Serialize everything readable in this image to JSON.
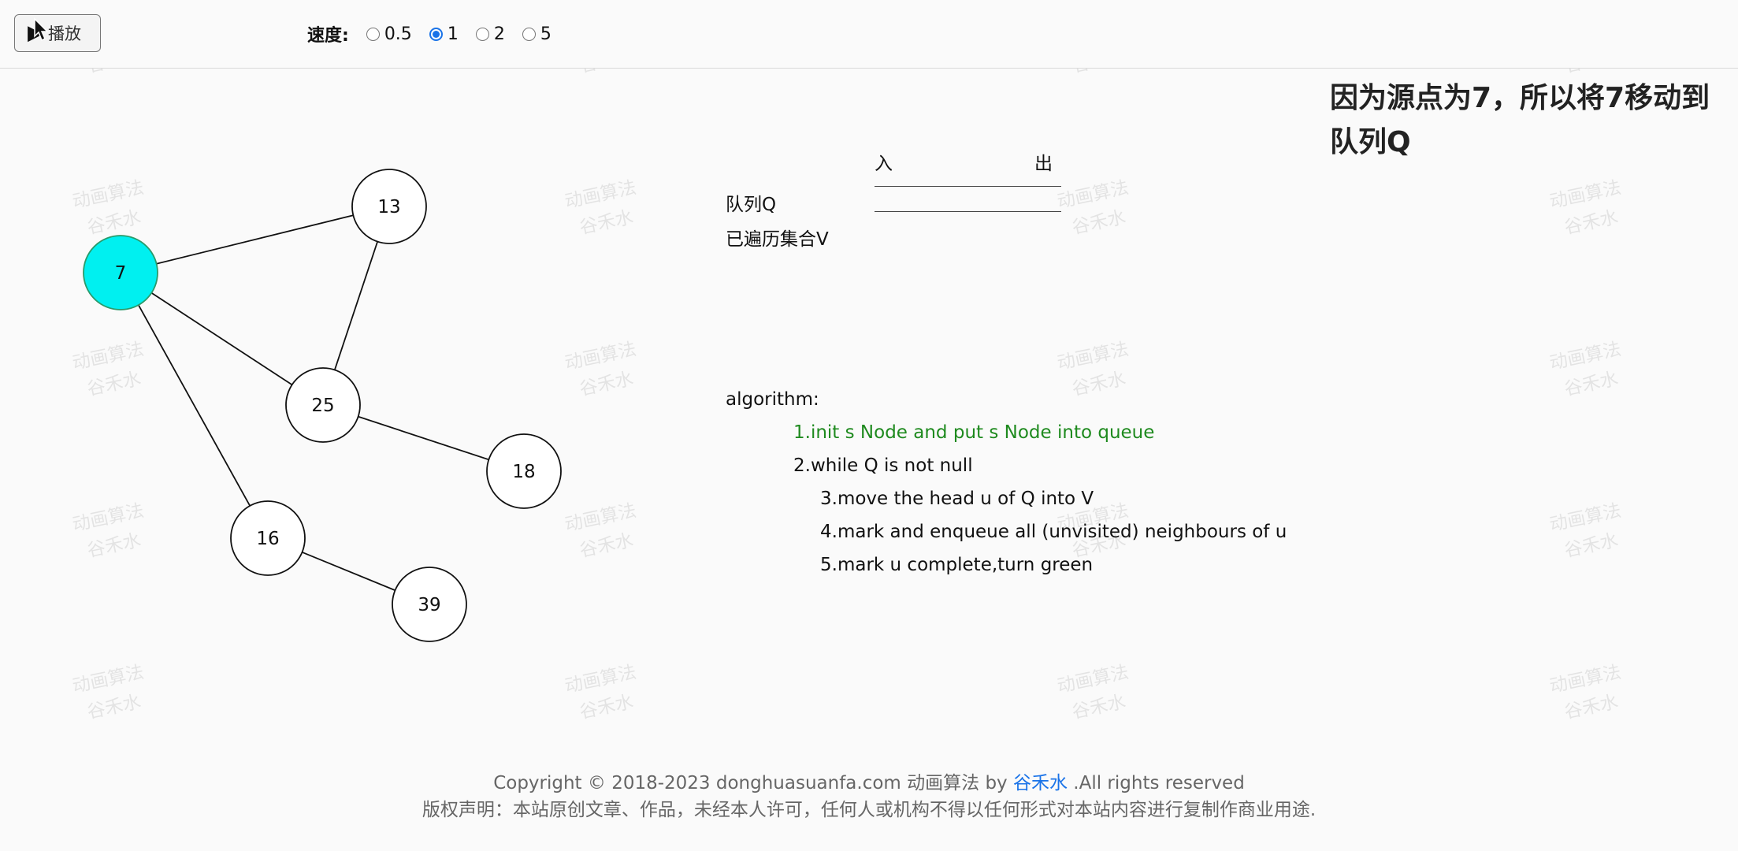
{
  "toolbar": {
    "play_label": "播放",
    "speed_label": "速度:",
    "speed_options": [
      "0.5",
      "1",
      "2",
      "5"
    ],
    "speed_selected": "1"
  },
  "watermark": {
    "line1": "动画算法",
    "line2": "谷禾水"
  },
  "graph": {
    "nodes": [
      {
        "id": "7",
        "label": "7",
        "highlight": true
      },
      {
        "id": "13",
        "label": "13"
      },
      {
        "id": "25",
        "label": "25"
      },
      {
        "id": "18",
        "label": "18"
      },
      {
        "id": "16",
        "label": "16"
      },
      {
        "id": "39",
        "label": "39"
      }
    ],
    "edges": [
      [
        "7",
        "13"
      ],
      [
        "7",
        "25"
      ],
      [
        "7",
        "16"
      ],
      [
        "13",
        "25"
      ],
      [
        "25",
        "18"
      ],
      [
        "16",
        "39"
      ]
    ],
    "highlight_color": "#00f0f0"
  },
  "queue": {
    "in_label": "入",
    "out_label": "出",
    "queue_label": "队列Q",
    "visited_label": "已遍历集合V"
  },
  "algorithm": {
    "title": "algorithm:",
    "steps": [
      "1.init s Node and put s Node into queue",
      "2.while Q is not null",
      "3.move the head u of Q into V",
      "4.mark and enqueue all (unvisited) neighbours of u",
      "5.mark u complete,turn green"
    ],
    "active_step": 0,
    "active_color": "#1e8a1e"
  },
  "explanation": {
    "line1": "因为源点为7，所以将7移动到",
    "line2": "队列Q"
  },
  "footer": {
    "copyright_prefix": "Copyright © 2018-2023 donghuasuanfa.com 动画算法 by ",
    "author": "谷禾水",
    "copyright_suffix": " .All rights reserved",
    "notice": "版权声明：本站原创文章、作品，未经本人许可，任何人或机构不得以任何形式对本站内容进行复制作商业用途."
  }
}
